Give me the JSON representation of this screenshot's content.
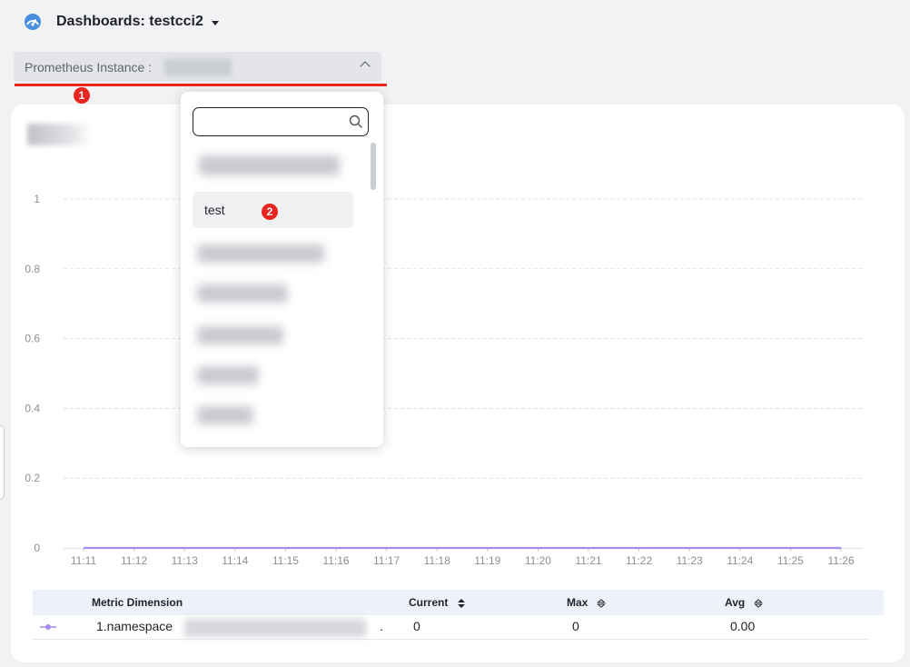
{
  "header": {
    "title": "Dashboards: testcci2",
    "icon": "gauge-icon"
  },
  "selector": {
    "label": "Prometheus Instance :"
  },
  "annotations": {
    "step1": "1",
    "step2": "2"
  },
  "dropdown": {
    "search_placeholder": "",
    "visible_option": "test"
  },
  "chart_data": {
    "type": "line",
    "x": [
      "11:11",
      "11:12",
      "11:13",
      "11:14",
      "11:15",
      "11:16",
      "11:17",
      "11:18",
      "11:19",
      "11:20",
      "11:21",
      "11:22",
      "11:23",
      "11:24",
      "11:25",
      "11:26"
    ],
    "yticks": [
      "0",
      "0.2",
      "0.4",
      "0.6",
      "0.8",
      "1"
    ],
    "ylim": [
      0,
      1
    ],
    "grid": true,
    "series": [
      {
        "name": "1.namespace",
        "color": "#a68bf0",
        "values": [
          0,
          0,
          0,
          0,
          0,
          0,
          0,
          0,
          0,
          0,
          0,
          0,
          0,
          0,
          0,
          0
        ]
      }
    ]
  },
  "table": {
    "headers": {
      "dimension": "Metric Dimension",
      "current": "Current",
      "max": "Max",
      "avg": "Avg"
    },
    "rows": [
      {
        "dimension": "1.namespace",
        "trail": ".",
        "current": "0",
        "max": "0",
        "avg": "0.00"
      }
    ]
  },
  "colors": {
    "accent_red": "#e8251f",
    "series": "#a68bf0",
    "gauge": "#4a90e2"
  }
}
